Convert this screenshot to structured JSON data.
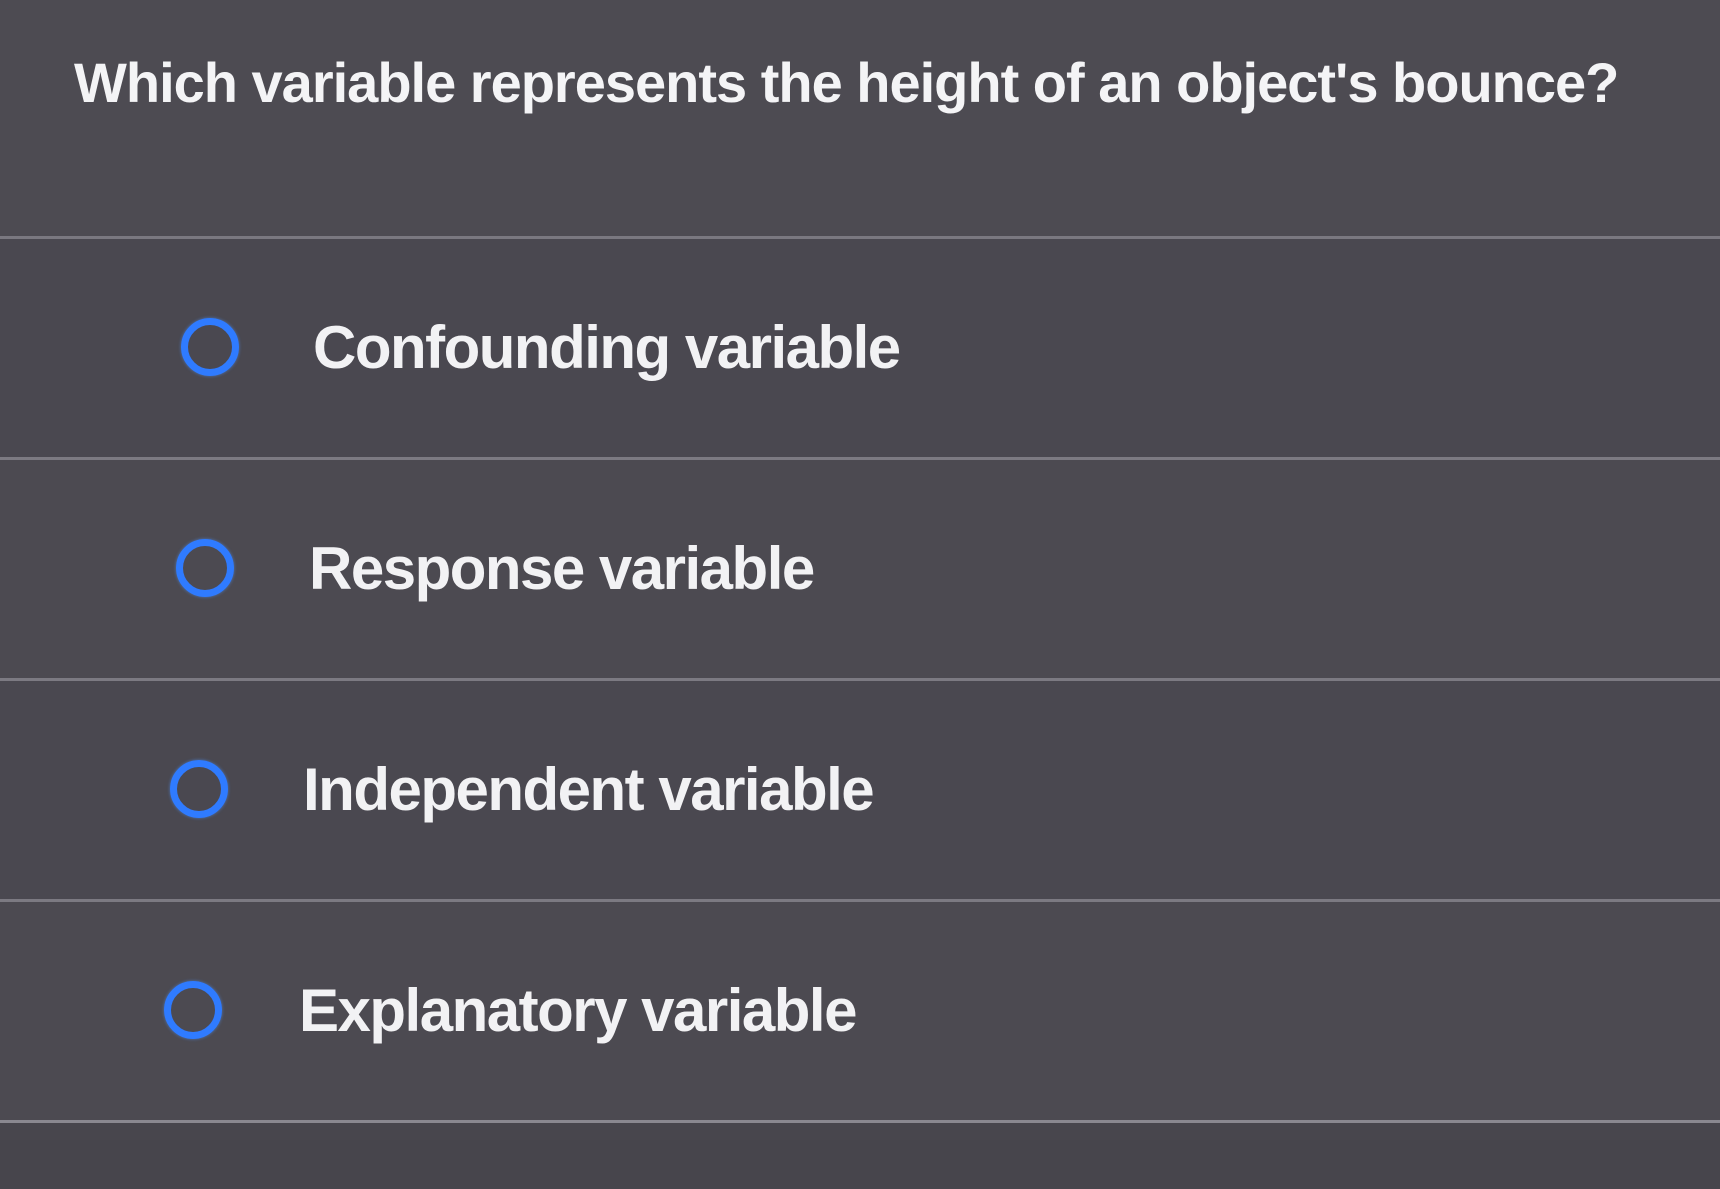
{
  "question": {
    "text": "Which variable represents the height of an object's bounce?"
  },
  "options": [
    {
      "label": "Confounding variable",
      "icon": "radio-unselected-icon",
      "selected": false
    },
    {
      "label": "Response variable",
      "icon": "radio-unselected-icon",
      "selected": false
    },
    {
      "label": "Independent variable",
      "icon": "radio-unselected-icon",
      "selected": false
    },
    {
      "label": "Explanatory variable",
      "icon": "radio-unselected-icon",
      "selected": false
    }
  ],
  "colors": {
    "background": "#4a484f",
    "radio_accent": "#2f7bff",
    "text": "#f2f2f4",
    "divider": "#7c7a82"
  }
}
